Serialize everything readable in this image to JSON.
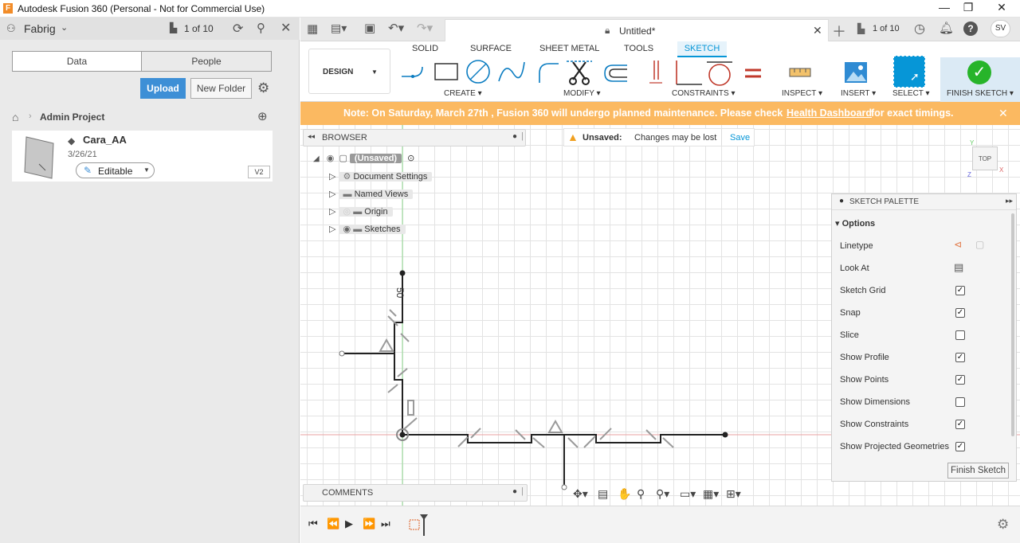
{
  "window": {
    "title": "Autodesk Fusion 360 (Personal - Not for Commercial Use)",
    "logo_letter": "F",
    "minimize": "—",
    "restore": "❐",
    "close": "✕"
  },
  "datapanel": {
    "team": "Fabrig",
    "counter": "1 of 10",
    "tabs": [
      "Data",
      "People"
    ],
    "upload": "Upload",
    "new_folder": "New Folder",
    "breadcrumb": "Admin Project",
    "file": {
      "name": "Cara_AA",
      "date": "3/26/21",
      "status": "Editable",
      "version": "V2"
    }
  },
  "appbar": {
    "doc_title": "Untitled*",
    "counter": "1 of 10",
    "avatar": "SV"
  },
  "toolbar": {
    "workspace": "DESIGN",
    "tabs": [
      "SOLID",
      "SURFACE",
      "SHEET METAL",
      "TOOLS",
      "SKETCH"
    ],
    "active_tab": "SKETCH",
    "groups": [
      "CREATE",
      "MODIFY",
      "CONSTRAINTS",
      "INSPECT",
      "INSERT",
      "SELECT",
      "FINISH SKETCH"
    ],
    "accent": "#0696d7"
  },
  "notice": {
    "text_before": "Note: On Saturday, March 27th , Fusion 360 will undergo planned maintenance. Please check ",
    "link": "Health Dashboard",
    "text_after": " for exact timings.",
    "color": "#fbb961"
  },
  "browser": {
    "title": "BROWSER",
    "root": "(Unsaved)",
    "items": [
      "Document Settings",
      "Named Views",
      "Origin",
      "Sketches"
    ]
  },
  "unsaved_banner": {
    "label": "Unsaved:",
    "message": "Changes may be lost",
    "save": "Save"
  },
  "viewcube": {
    "face": "TOP"
  },
  "sketch": {
    "dimension": "50"
  },
  "palette": {
    "title": "SKETCH PALETTE",
    "section": "Options",
    "options": [
      {
        "label": "Linetype",
        "checked": null
      },
      {
        "label": "Look At",
        "checked": null
      },
      {
        "label": "Sketch Grid",
        "checked": true
      },
      {
        "label": "Snap",
        "checked": true
      },
      {
        "label": "Slice",
        "checked": false
      },
      {
        "label": "Show Profile",
        "checked": true
      },
      {
        "label": "Show Points",
        "checked": true
      },
      {
        "label": "Show Dimensions",
        "checked": false
      },
      {
        "label": "Show Constraints",
        "checked": true
      },
      {
        "label": "Show Projected Geometries",
        "checked": true
      }
    ],
    "finish": "Finish Sketch"
  },
  "comments": {
    "title": "COMMENTS"
  }
}
